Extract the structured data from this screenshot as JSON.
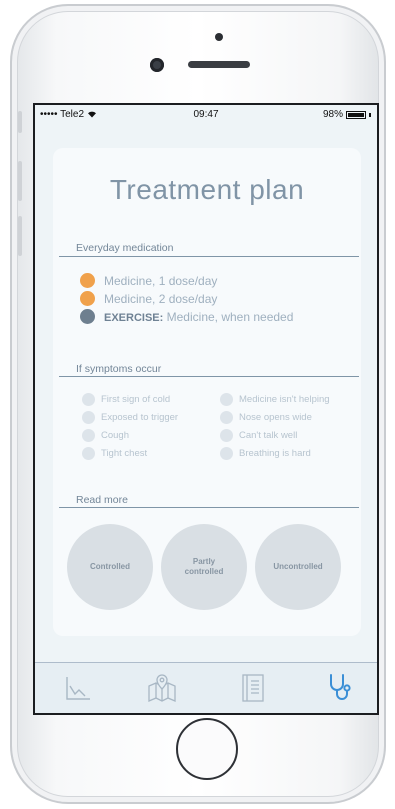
{
  "status_bar": {
    "carrier": "••••• Tele2",
    "time": "09:47",
    "battery": "98%"
  },
  "page": {
    "title": "Treatment plan"
  },
  "everyday": {
    "heading": "Everyday medication",
    "items": [
      {
        "label": "Medicine, 1 dose/day",
        "color": "#f0a14b"
      },
      {
        "label": "Medicine, 2 dose/day",
        "color": "#f0a14b"
      },
      {
        "prefix": "EXERCISE:",
        "label": "Medicine, when needed",
        "color": "#6e7f8f"
      }
    ]
  },
  "symptoms": {
    "heading": "If symptoms occur",
    "left": [
      "First sign of cold",
      "Exposed to trigger",
      "Cough",
      "Tight chest"
    ],
    "right": [
      "Medicine isn't helping",
      "Nose opens wide",
      "Can't talk well",
      "Breathing is hard"
    ]
  },
  "read_more": {
    "heading": "Read more",
    "buttons": [
      "Controlled",
      "Partly\ncontrolled",
      "Uncontrolled"
    ]
  },
  "tabs": [
    {
      "icon": "chart-icon",
      "active": false
    },
    {
      "icon": "map-icon",
      "active": false
    },
    {
      "icon": "notebook-icon",
      "active": false
    },
    {
      "icon": "stethoscope-icon",
      "active": true
    }
  ],
  "colors": {
    "accent": "#3b8fd6",
    "inactive_icon": "#a8b7c4",
    "orange": "#f0a14b"
  }
}
